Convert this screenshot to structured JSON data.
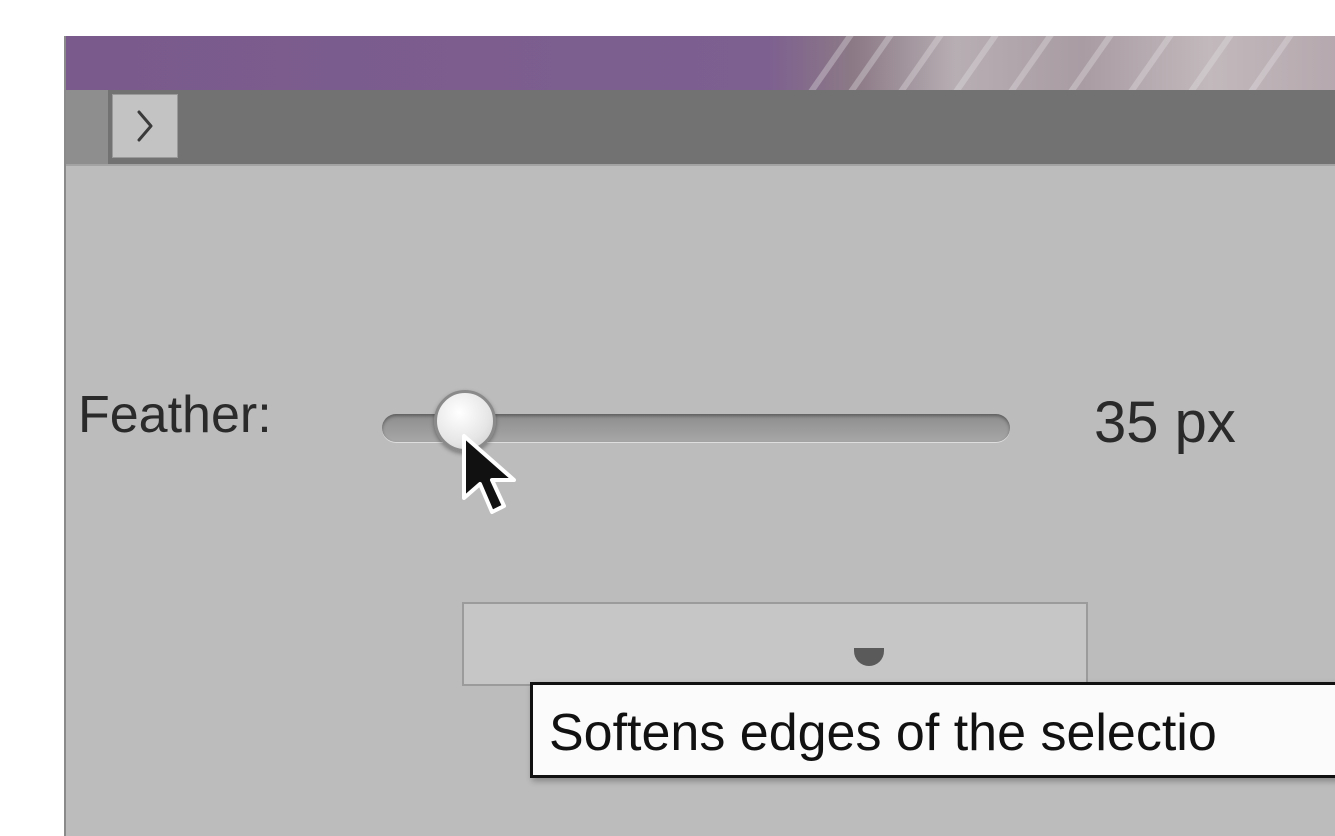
{
  "panel": {
    "feather_label": "Feather:",
    "feather_value": 35,
    "feather_value_text": "35 px",
    "feather_unit": "px"
  },
  "tooltip": {
    "text": "Softens edges of the selectio"
  },
  "icons": {
    "expand": "chevron-right-icon",
    "cursor": "mouse-pointer-icon"
  },
  "colors": {
    "canvas_accent": "#7a5a8c",
    "toolbar_bg": "#727272",
    "panel_bg": "#bcbcbc",
    "tooltip_bg": "#fbfbfb"
  }
}
